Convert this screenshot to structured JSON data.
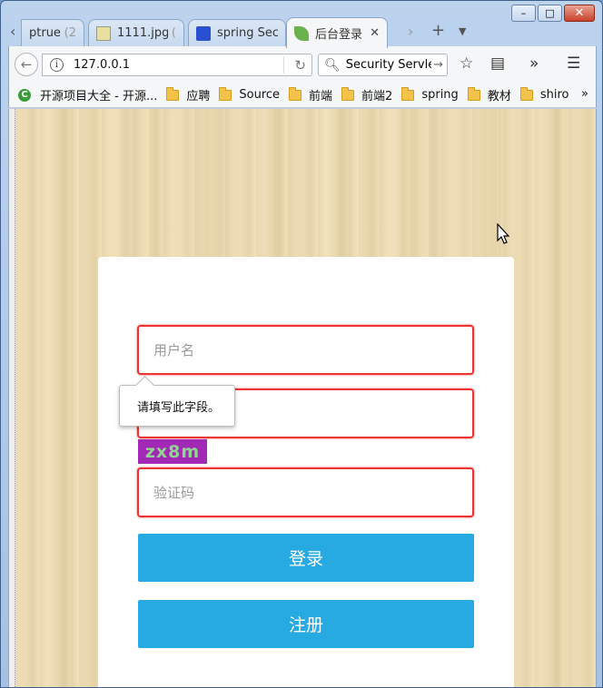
{
  "browser": {
    "tabs": [
      {
        "label": "ptrue",
        "faded": "(2"
      },
      {
        "label": "1111.jpg",
        "faded": "("
      },
      {
        "label": "spring Sec",
        "faded": ""
      },
      {
        "label": "后台登录",
        "faded": ""
      }
    ],
    "window_controls": {
      "minimize": "–",
      "maximize": "□",
      "close": "✕"
    },
    "url": "127.0.0.1",
    "search_text": "Security Servlet",
    "bookmarks": [
      "开源项目大全 - 开源...",
      "应聘",
      "Source",
      "前端",
      "前端2",
      "spring",
      "教材",
      "shiro"
    ],
    "bookmarks_overflow": "»"
  },
  "login": {
    "username_placeholder": "用户名",
    "captcha_placeholder": "验证码",
    "captcha_text": "zx8m",
    "validation_tooltip": "请填写此字段。",
    "login_button": "登录",
    "register_button": "注册"
  },
  "colors": {
    "accent": "#27a9e1",
    "error_border": "#e33333",
    "captcha_bg": "#a229b5",
    "captcha_fg": "#8fd68f"
  }
}
